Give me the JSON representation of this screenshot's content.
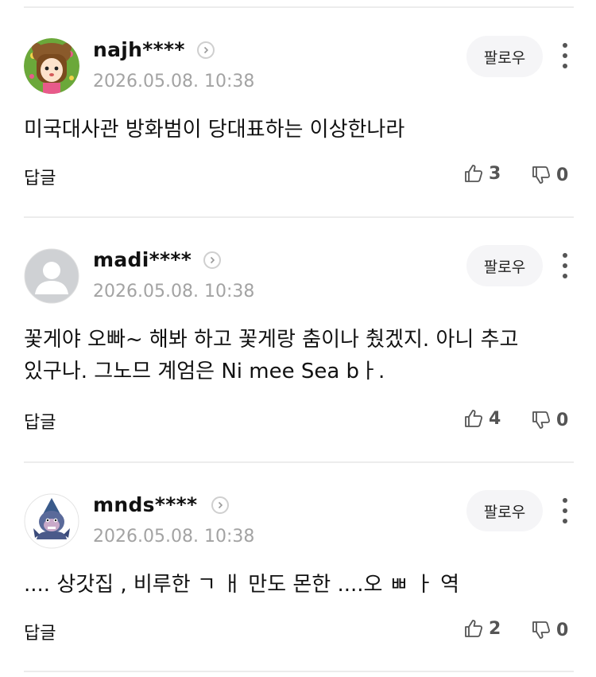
{
  "comments": [
    {
      "nickname": "najh****",
      "date": "2026.05.08. 10:38",
      "text": "미국대사관 방화범이 당대표하는 이상한나라",
      "follow_label": "팔로우",
      "reply_label": "답글",
      "likes": "3",
      "dislikes": "0",
      "avatar": "brown-bear-girl-avatar"
    },
    {
      "nickname": "madi****",
      "date": "2026.05.08. 10:38",
      "text": "꽃게야 오빠~ 해봐 하고 꽃게랑 춤이나 췄겠지. 아니 추고 있구나. 그노므 계엄은 Ni mee Sea bㅏ.",
      "follow_label": "팔로우",
      "reply_label": "답글",
      "likes": "4",
      "dislikes": "0",
      "avatar": "default-user-avatar"
    },
    {
      "nickname": "mnds****",
      "date": "2026.05.08. 10:38",
      "text": ".... 상갓집 , 비루한 ㄱ ㅐ 만도 몬한 ....오 ㅃ ㅏ 역",
      "follow_label": "팔로우",
      "reply_label": "답글",
      "likes": "2",
      "dislikes": "0",
      "avatar": "gorilla-character-avatar"
    }
  ],
  "colors": {
    "date": "#a3a3a3",
    "follow_bg": "#f5f5f7",
    "separator": "#ececec",
    "vote": "#555555"
  }
}
